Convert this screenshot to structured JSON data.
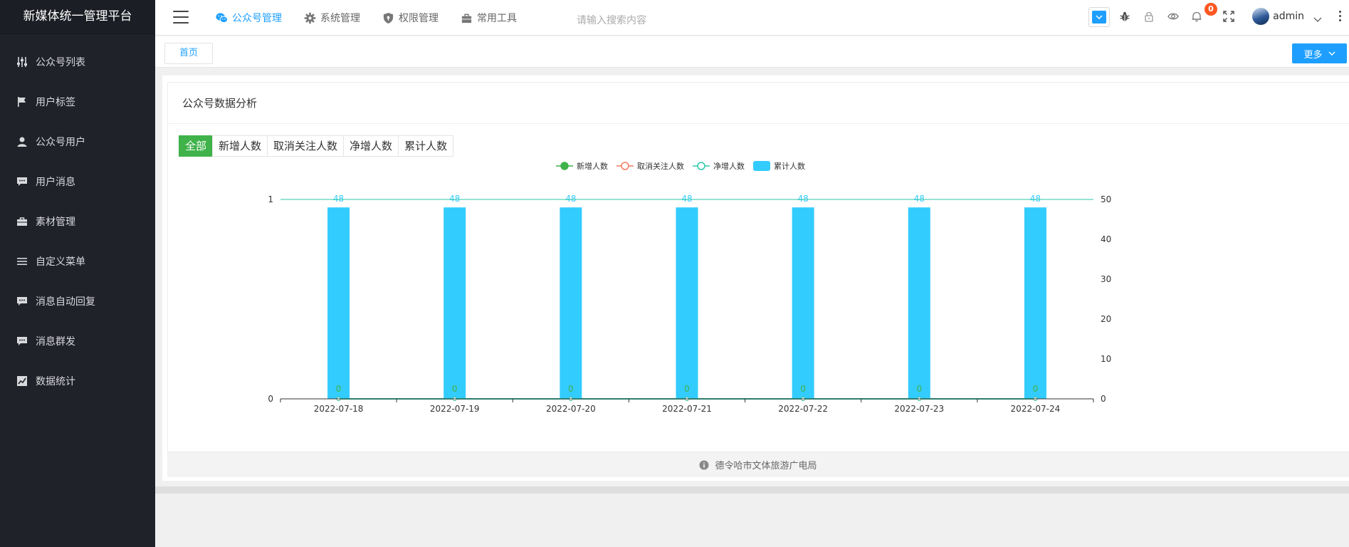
{
  "app": {
    "title": "新媒体统一管理平台"
  },
  "sidebar": {
    "items": [
      {
        "label": "公众号列表",
        "icon": "sliders-icon"
      },
      {
        "label": "用户标签",
        "icon": "flag-icon"
      },
      {
        "label": "公众号用户",
        "icon": "user-icon"
      },
      {
        "label": "用户消息",
        "icon": "message-icon"
      },
      {
        "label": "素材管理",
        "icon": "briefcase-icon"
      },
      {
        "label": "自定义菜单",
        "icon": "list-icon"
      },
      {
        "label": "消息自动回复",
        "icon": "message-icon"
      },
      {
        "label": "消息群发",
        "icon": "message-icon"
      },
      {
        "label": "数据统计",
        "icon": "chart-icon"
      }
    ]
  },
  "header": {
    "nav": [
      {
        "label": "公众号管理",
        "icon": "wechat-icon",
        "active": true
      },
      {
        "label": "系统管理",
        "icon": "gear-icon",
        "active": false
      },
      {
        "label": "权限管理",
        "icon": "shield-icon",
        "active": false
      },
      {
        "label": "常用工具",
        "icon": "toolbox-icon",
        "active": false
      }
    ],
    "search_placeholder": "请输入搜索内容",
    "notification_count": "0",
    "username": "admin",
    "accent_color": "#1e9fff"
  },
  "tabs": {
    "home": "首页",
    "more": "更多"
  },
  "panel": {
    "title": "公众号数据分析",
    "filters": [
      {
        "label": "全部",
        "active": true
      },
      {
        "label": "新增人数",
        "active": false
      },
      {
        "label": "取消关注人数",
        "active": false
      },
      {
        "label": "净增人数",
        "active": false
      },
      {
        "label": "累计人数",
        "active": false
      }
    ]
  },
  "chart_data": {
    "type": "bar",
    "categories": [
      "2022-07-18",
      "2022-07-19",
      "2022-07-20",
      "2022-07-21",
      "2022-07-22",
      "2022-07-23",
      "2022-07-24"
    ],
    "series": [
      {
        "name": "新增人数",
        "type": "line",
        "axis": "left",
        "color": "#3fb24a",
        "values": [
          0,
          0,
          0,
          0,
          0,
          0,
          0
        ]
      },
      {
        "name": "取消关注人数",
        "type": "line",
        "axis": "left",
        "color": "#f47b5e",
        "values": [
          0,
          0,
          0,
          0,
          0,
          0,
          0
        ]
      },
      {
        "name": "净增人数",
        "type": "line",
        "axis": "left",
        "color": "#2ec7a9",
        "values": [
          0,
          0,
          0,
          0,
          0,
          0,
          0
        ]
      },
      {
        "name": "累计人数",
        "type": "bar",
        "axis": "right",
        "color": "#33ccff",
        "values": [
          48,
          48,
          48,
          48,
          48,
          48,
          48
        ]
      }
    ],
    "left_axis": {
      "ylim": [
        0,
        1
      ],
      "ticks": [
        0,
        1
      ]
    },
    "right_axis": {
      "ylim": [
        0,
        50
      ],
      "ticks": [
        0,
        10,
        20,
        30,
        40,
        50
      ]
    },
    "legend_position": "top-center",
    "grid": false
  },
  "footer": {
    "text": "德令哈市文体旅游广电局"
  }
}
